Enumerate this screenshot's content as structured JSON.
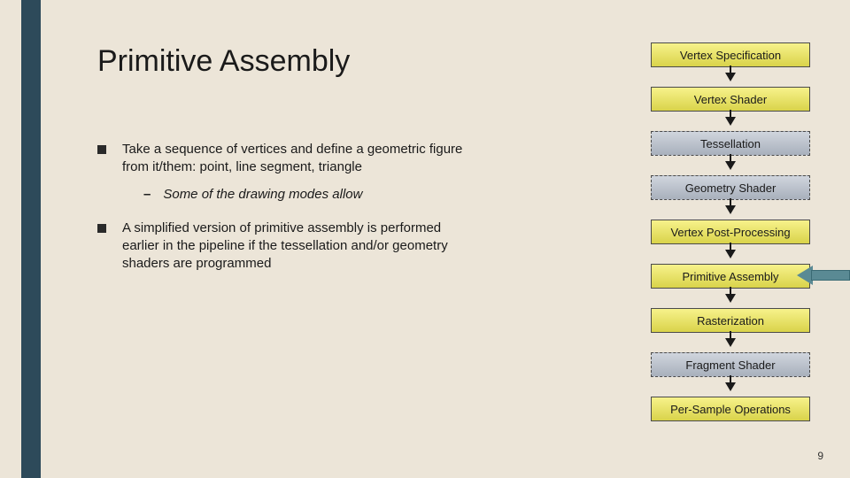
{
  "title": "Primitive Assembly",
  "bullets": [
    {
      "text": "Take a sequence of vertices and define a geometric figure from it/them: point, line segment, triangle",
      "sub": "Some of the drawing modes allow"
    },
    {
      "text": "A simplified version of primitive assembly is performed earlier in the pipeline if the tessellation and/or geometry shaders are programmed",
      "sub": null
    }
  ],
  "pipeline": [
    {
      "label": "Vertex Specification",
      "dashed": false
    },
    {
      "label": "Vertex Shader",
      "dashed": false
    },
    {
      "label": "Tessellation",
      "dashed": true
    },
    {
      "label": "Geometry Shader",
      "dashed": true
    },
    {
      "label": "Vertex Post-Processing",
      "dashed": false
    },
    {
      "label": "Primitive Assembly",
      "dashed": false
    },
    {
      "label": "Rasterization",
      "dashed": false
    },
    {
      "label": "Fragment Shader",
      "dashed": true
    },
    {
      "label": "Per-Sample Operations",
      "dashed": false
    }
  ],
  "page_number": "9"
}
